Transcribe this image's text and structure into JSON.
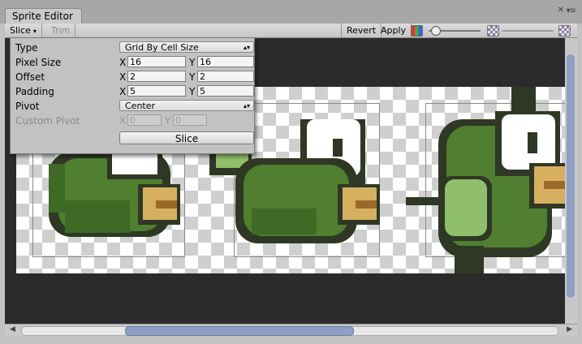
{
  "window": {
    "title": "Sprite Editor"
  },
  "toolbar": {
    "slice_label": "Slice",
    "trim_label": "Trim",
    "revert_label": "Revert",
    "apply_label": "Apply",
    "zoom_slider_level": 0.05,
    "mip_slider_level": 0.0
  },
  "panel": {
    "type": {
      "label": "Type",
      "value": "Grid By Cell Size"
    },
    "pixel_size": {
      "label": "Pixel Size",
      "x_label": "X",
      "x": "16",
      "y_label": "Y",
      "y": "16"
    },
    "offset": {
      "label": "Offset",
      "x_label": "X",
      "x": "2",
      "y_label": "Y",
      "y": "2"
    },
    "padding": {
      "label": "Padding",
      "x_label": "X",
      "x": "5",
      "y_label": "Y",
      "y": "5"
    },
    "pivot": {
      "label": "Pivot",
      "value": "Center"
    },
    "custom_pivot": {
      "label": "Custom Pivot",
      "x_label": "X",
      "x": "0",
      "y_label": "Y",
      "y": "0"
    },
    "slice_button": "Slice"
  },
  "colors": {
    "sprite_dark": "#2e3824",
    "sprite_mid": "#3f6a25",
    "sprite_green": "#4f7f2f",
    "sprite_light": "#8fbf6a",
    "sprite_beak": "#d6b060",
    "sprite_beak_dark": "#9a6a28",
    "scroll_thumb": "#8e9fc4"
  },
  "icons": {
    "color_channels": "rgb-channels-icon",
    "alpha": "alpha-checker-icon",
    "mip": "mip-checker-icon"
  }
}
